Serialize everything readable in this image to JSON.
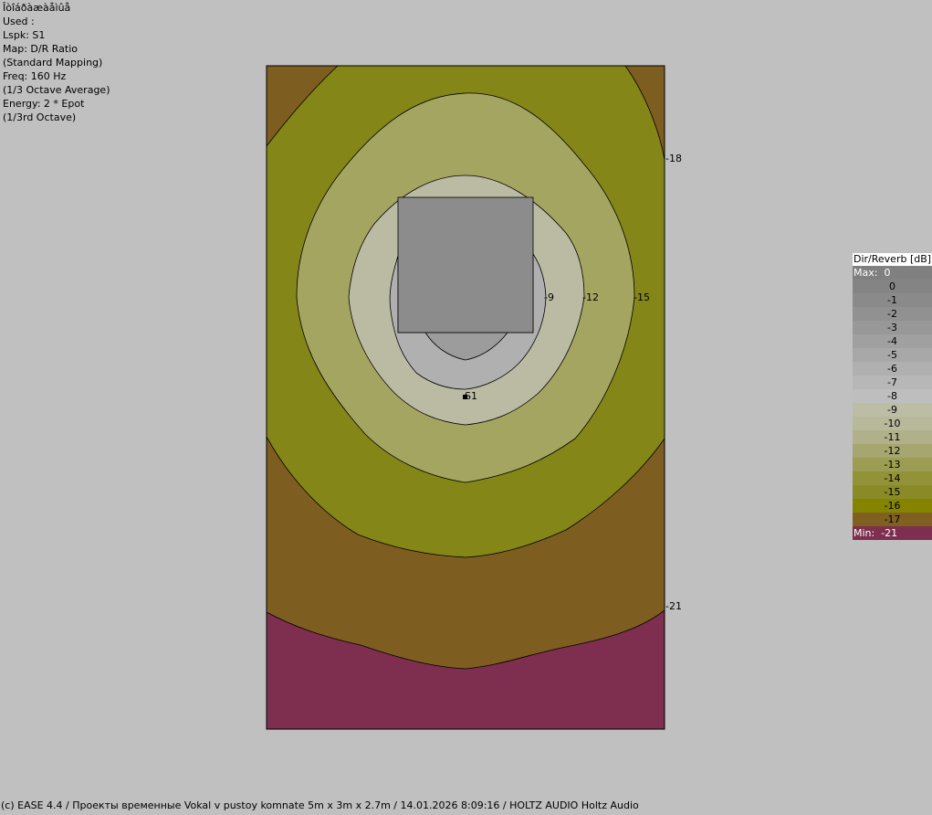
{
  "info": {
    "lines": [
      "Îòîáðàæàåìûå",
      "Used :",
      "Lspk: S1",
      "Map: D/R Ratio",
      "(Standard Mapping)",
      "Freq: 160 Hz",
      "(1/3 Octave Average)",
      "Energy: 2 * Epot",
      "(1/3rd Octave)"
    ]
  },
  "map": {
    "speaker_label": "S1",
    "contour_labels": [
      "-18",
      "-9",
      "-12",
      "-15",
      "-21"
    ]
  },
  "legend": {
    "title": "Dir/Reverb [dB]",
    "max_label": "Max:  0",
    "min_label": "Min:  -21",
    "max_color": "#808080",
    "min_color": "#7e2e4e",
    "rows": [
      {
        "value": "0",
        "color": "#848484"
      },
      {
        "value": "-1",
        "color": "#8a8a8a"
      },
      {
        "value": "-2",
        "color": "#919191"
      },
      {
        "value": "-3",
        "color": "#989898"
      },
      {
        "value": "-4",
        "color": "#a0a0a0"
      },
      {
        "value": "-5",
        "color": "#a8a8a8"
      },
      {
        "value": "-6",
        "color": "#b0b0b0"
      },
      {
        "value": "-7",
        "color": "#b7b7b7"
      },
      {
        "value": "-8",
        "color": "#bebebe"
      },
      {
        "value": "-9",
        "color": "#bdbda6"
      },
      {
        "value": "-10",
        "color": "#b8b89a"
      },
      {
        "value": "-11",
        "color": "#b0b08a"
      },
      {
        "value": "-12",
        "color": "#a6a670"
      },
      {
        "value": "-13",
        "color": "#9c9c52"
      },
      {
        "value": "-14",
        "color": "#929238"
      },
      {
        "value": "-15",
        "color": "#8a8a26"
      },
      {
        "value": "-16",
        "color": "#848400"
      },
      {
        "value": "-17",
        "color": "#806020"
      }
    ]
  },
  "footer": "(c) EASE 4.4  / Проекты временные Vokal v pustoy komnate 5m x 3m x 2.7m / 14.01.2026 8:09:16 / HOLTZ AUDIO Holtz Audio"
}
